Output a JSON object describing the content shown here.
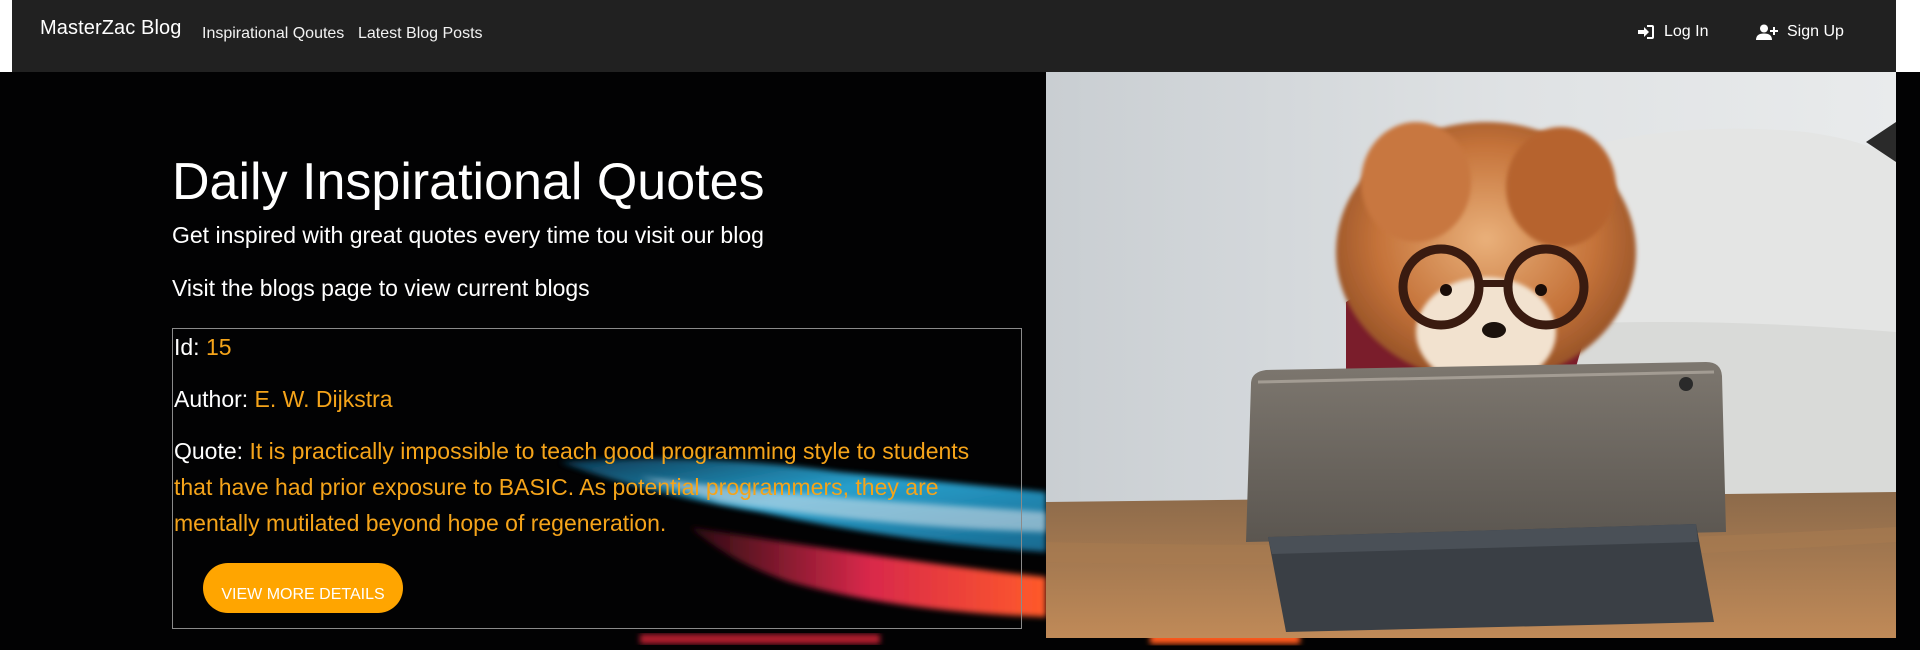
{
  "navbar": {
    "brand": "MasterZac Blog",
    "links": [
      "Inspirational Qoutes",
      "Latest Blog Posts"
    ],
    "login_label": "Log In",
    "signup_label": "Sign Up",
    "login_icon": "sign-in-icon",
    "signup_icon": "user-plus-icon"
  },
  "hero": {
    "title": "Daily Inspirational Quotes",
    "subtitle": "Get inspired with great quotes every time tou visit our blog",
    "subtitle2": "Visit the blogs page to view current blogs"
  },
  "quote": {
    "id_label": "Id:",
    "id_value": "15",
    "author_label": "Author:",
    "author_value": "E. W. Dijkstra",
    "quote_label": "Quote:",
    "quote_value": "It is practically impossible to teach good programming style to students that have had prior exposure to BASIC. As potential programmers, they are mentally mutilated beyond hope of regeneration.",
    "button_label": "VIEW MORE DETAILS"
  },
  "colors": {
    "navbar_bg": "#212121",
    "accent_orange": "#FFA500",
    "quote_text": "#F5A41A"
  }
}
